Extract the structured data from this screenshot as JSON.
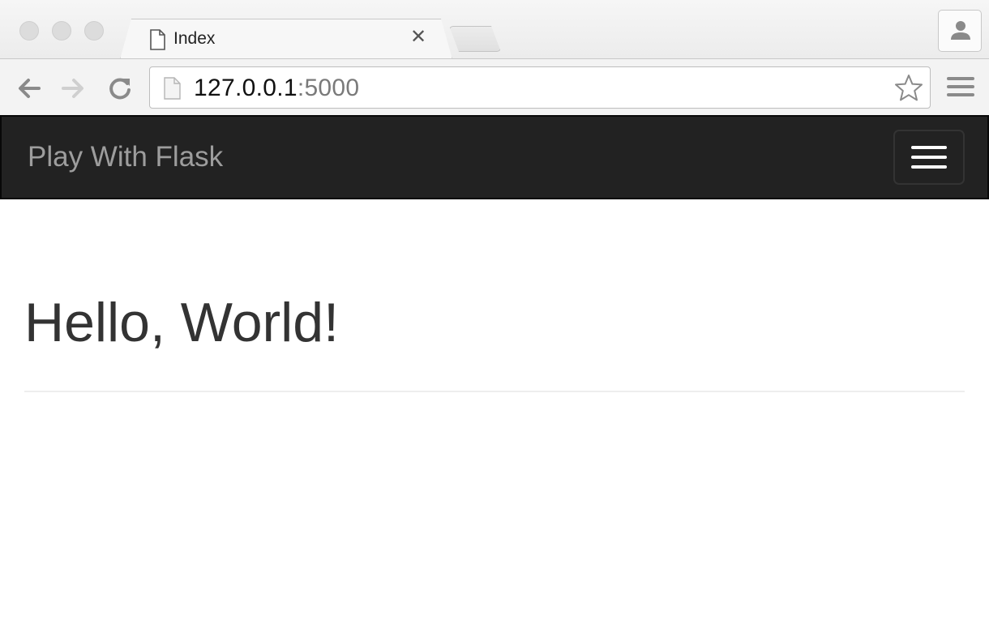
{
  "browser": {
    "tab": {
      "title": "Index",
      "close_glyph": "✕"
    },
    "address": {
      "host": "127.0.0.1",
      "port": ":5000"
    },
    "icons": {
      "back": "back-arrow-icon",
      "forward": "forward-arrow-icon",
      "reload": "reload-icon",
      "bookmark": "star-icon",
      "menu": "hamburger-menu-icon",
      "profile": "person-icon",
      "page": "document-icon"
    }
  },
  "page": {
    "brand": "Play With Flask",
    "heading": "Hello, World!"
  },
  "colors": {
    "navbar_bg": "#222222",
    "brand_text": "#9d9d9d",
    "heading_text": "#333333",
    "rule": "#eeeeee"
  }
}
